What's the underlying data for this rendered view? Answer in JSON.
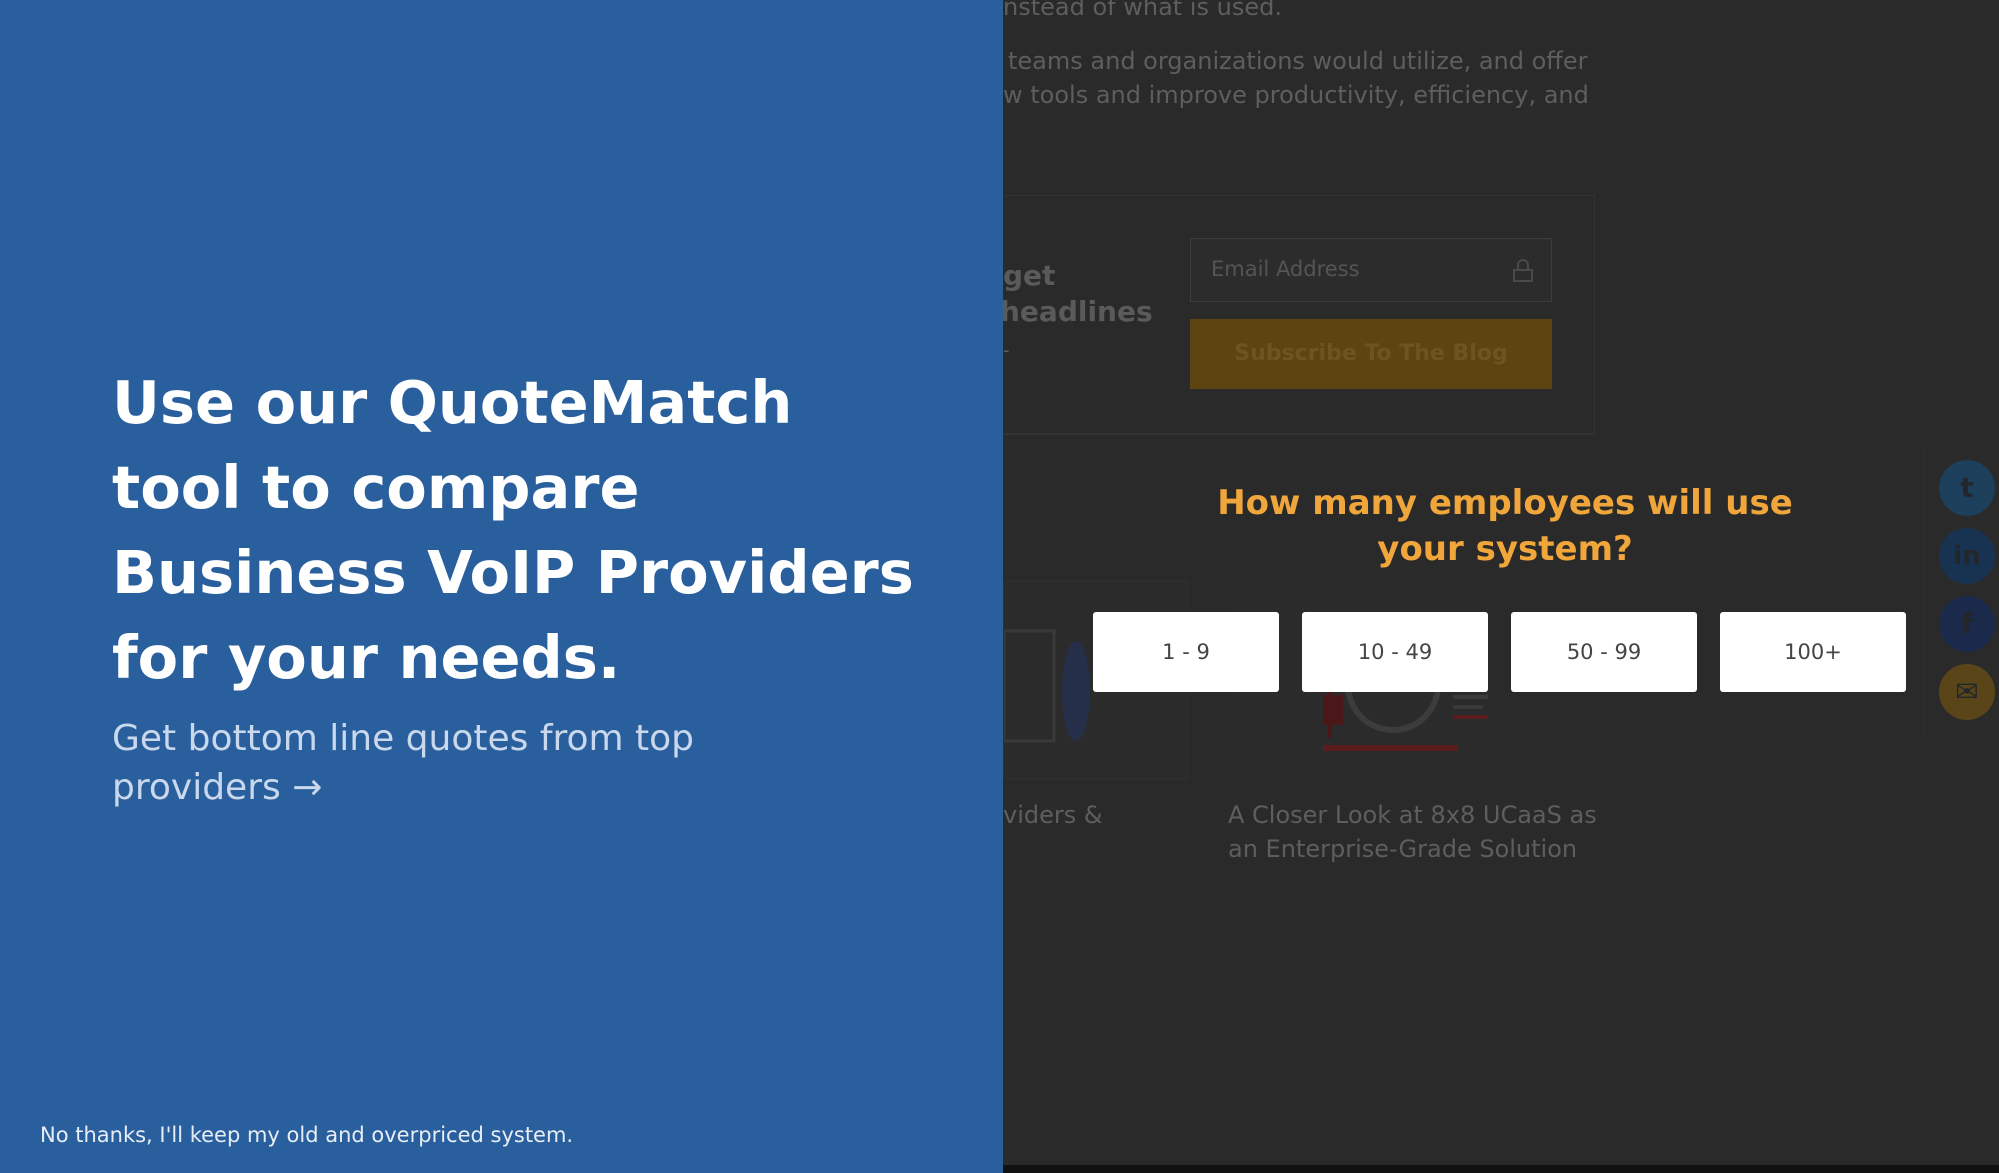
{
  "background": {
    "intro_line": "nstead of what is used.",
    "paragraph_lines": [
      "teams and organizations would utilize, and offer",
      "w tools and improve productivity, efficiency, and"
    ],
    "newsletter_heading_lines": [
      "get",
      "headlines"
    ],
    "newsletter_heading_tail": "-",
    "email_placeholder": "Email Address",
    "subscribe_label": "Subscribe To The Blog",
    "article_left_title": "viders &",
    "article_right_title_lines": [
      "A Closer Look at 8x8 UCaaS as",
      "an Enterprise-Grade Solution"
    ]
  },
  "social": [
    {
      "name": "twitter",
      "glyph": "t",
      "color": "#1c3f5c"
    },
    {
      "name": "linkedin",
      "glyph": "in",
      "color": "#183252"
    },
    {
      "name": "facebook",
      "glyph": "f",
      "color": "#1b2a4a"
    },
    {
      "name": "email",
      "glyph": "✉",
      "color": "#5a4518"
    }
  ],
  "promo": {
    "headline": "Use our QuoteMatch tool to compare Business VoIP Providers for your needs.",
    "subtext": "Get bottom line quotes from top providers →",
    "decline": "No thanks, I'll keep my old and overpriced system."
  },
  "question": {
    "text": "How many employees will use your system?",
    "options": [
      "1 - 9",
      "10 - 49",
      "50 - 99",
      "100+"
    ]
  },
  "colors": {
    "panel": "#2a5f9e",
    "accent": "#f0a63a",
    "overlay": "#2a2a2a"
  }
}
